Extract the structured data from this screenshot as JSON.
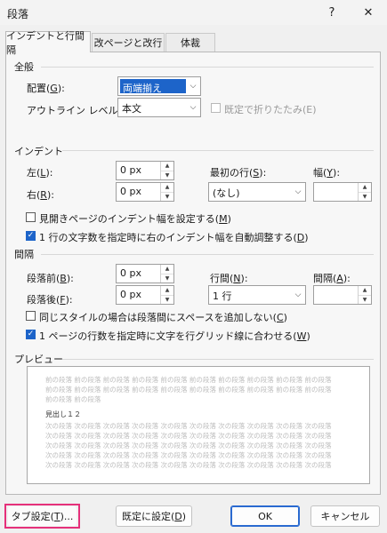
{
  "window": {
    "title": "段落",
    "help": "?",
    "close": "✕"
  },
  "tabs": [
    {
      "label": "インデントと行間隔"
    },
    {
      "label": "改ページと改行"
    },
    {
      "label": "体裁"
    }
  ],
  "general": {
    "heading": "全般",
    "alignment_label": "配置(",
    "alignment_key": "G",
    "alignment_close": "):",
    "alignment_value": "両端揃え",
    "outline_label": "アウトライン レベル(",
    "outline_key": "O",
    "outline_close": "):",
    "outline_value": "本文",
    "collapse_label": "既定で折りたたみ(E)"
  },
  "indent": {
    "heading": "インデント",
    "left_label": "左(",
    "left_key": "L",
    "left_close": "):",
    "left_value": "0 px",
    "right_label": "右(",
    "right_key": "R",
    "right_close": "):",
    "right_value": "0 px",
    "first_line_label": "最初の行(",
    "first_line_key": "S",
    "first_line_close": "):",
    "first_line_value": "(なし)",
    "width_label": "幅(",
    "width_key": "Y",
    "width_close": "):",
    "width_value": "",
    "mirror_label": "見開きページのインデント幅を設定する(",
    "mirror_key": "M",
    "mirror_close": ")",
    "mirror_checked": false,
    "auto_adjust_label": "1 行の文字数を指定時に右のインデント幅を自動調整する(",
    "auto_adjust_key": "D",
    "auto_adjust_close": ")",
    "auto_adjust_checked": true
  },
  "spacing": {
    "heading": "間隔",
    "before_label": "段落前(",
    "before_key": "B",
    "before_close": "):",
    "before_value": "0 px",
    "after_label": "段落後(",
    "after_key": "F",
    "after_close": "):",
    "after_value": "0 px",
    "line_spacing_label": "行間(",
    "line_spacing_key": "N",
    "line_spacing_close": "):",
    "line_spacing_value": "1 行",
    "at_label": "間隔(",
    "at_key": "A",
    "at_close": "):",
    "at_value": "",
    "no_space_label": "同じスタイルの場合は段落間にスペースを追加しない(",
    "no_space_key": "C",
    "no_space_close": ")",
    "no_space_checked": false,
    "snap_grid_label": "1 ページの行数を指定時に文字を行グリッド線に合わせる(",
    "snap_grid_key": "W",
    "snap_grid_close": ")",
    "snap_grid_checked": true
  },
  "preview": {
    "heading": "プレビュー",
    "prev_lines": [
      "前の段落 前の段落 前の段落 前の段落 前の段落 前の段落 前の段落 前の段落 前の段落 前の段落",
      "前の段落 前の段落 前の段落 前の段落 前の段落 前の段落 前の段落 前の段落 前の段落 前の段落",
      "前の段落 前の段落"
    ],
    "current_text": "見出し１２",
    "next_lines": [
      "次の段落 次の段落 次の段落 次の段落 次の段落 次の段落 次の段落 次の段落 次の段落 次の段落",
      "次の段落 次の段落 次の段落 次の段落 次の段落 次の段落 次の段落 次の段落 次の段落 次の段落",
      "次の段落 次の段落 次の段落 次の段落 次の段落 次の段落 次の段落 次の段落 次の段落 次の段落",
      "次の段落 次の段落 次の段落 次の段落 次の段落 次の段落 次の段落 次の段落 次の段落 次の段落",
      "次の段落 次の段落 次の段落 次の段落 次の段落 次の段落 次の段落 次の段落 次の段落 次の段落"
    ]
  },
  "buttons": {
    "tabs_label": "タブ設定(",
    "tabs_key": "T",
    "tabs_close": ")...",
    "default_label": "既定に設定(",
    "default_key": "D",
    "default_close": ")",
    "ok_label": "OK",
    "cancel_label": "キャンセル"
  },
  "colors": {
    "highlight": "#e5307a",
    "accent": "#1d64c9"
  }
}
